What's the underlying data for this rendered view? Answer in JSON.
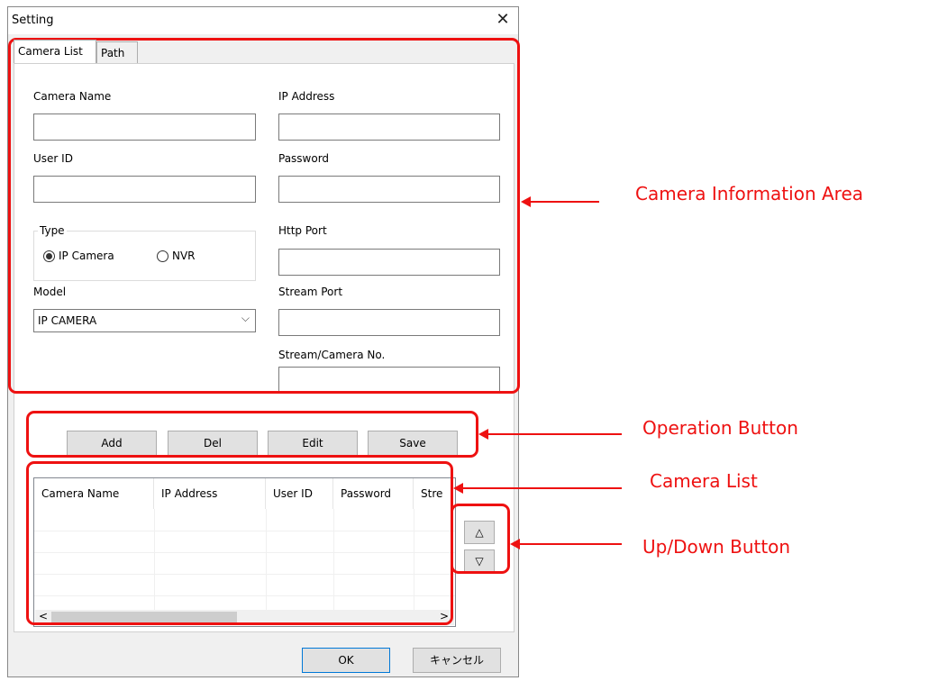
{
  "dialog": {
    "title": "Setting",
    "close_glyph": "✕",
    "tabs": [
      {
        "label": "Camera List"
      },
      {
        "label": "Path"
      }
    ]
  },
  "form": {
    "camera_name_label": "Camera Name",
    "camera_name_value": "",
    "ip_address_label": "IP Address",
    "ip_address_value": "",
    "user_id_label": "User ID",
    "user_id_value": "",
    "password_label": "Password",
    "password_value": "",
    "type_group_label": "Type",
    "type_options": [
      "IP Camera",
      "NVR"
    ],
    "type_selected": "IP Camera",
    "http_port_label": "Http Port",
    "http_port_value": "",
    "model_label": "Model",
    "model_value": "IP CAMERA",
    "stream_port_label": "Stream Port",
    "stream_port_value": "",
    "stream_camera_no_label": "Stream/Camera No.",
    "stream_camera_no_value": ""
  },
  "operations": {
    "add": "Add",
    "del": "Del",
    "edit": "Edit",
    "save": "Save"
  },
  "camera_list": {
    "columns": [
      "Camera Name",
      "IP Address",
      "User ID",
      "Password",
      "Stre"
    ],
    "rows": []
  },
  "updown": {
    "up_glyph": "△",
    "down_glyph": "▽"
  },
  "scrollbar": {
    "left_glyph": "<",
    "right_glyph": ">"
  },
  "footer": {
    "ok": "OK",
    "cancel": "キャンセル"
  },
  "annotations": {
    "camera_info_area": "Camera Information Area",
    "operation_button": "Operation Button",
    "camera_list": "Camera List",
    "updown_button": "Up/Down Button"
  },
  "colors": {
    "annotation_red": "#ee1111",
    "dialog_bg": "#f0f0f0"
  }
}
